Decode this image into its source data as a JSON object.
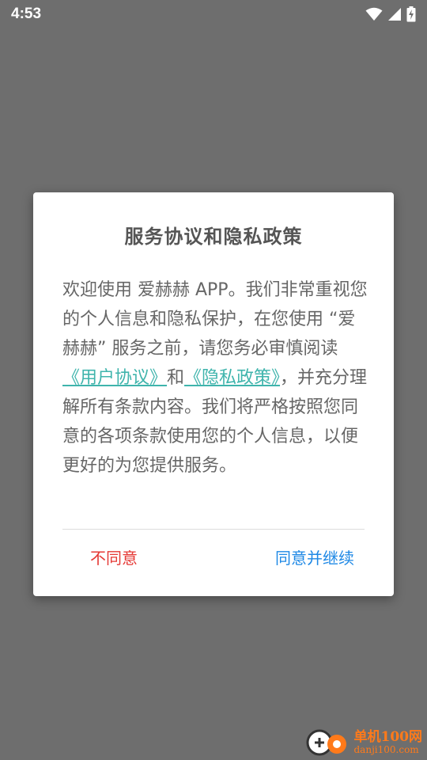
{
  "status_bar": {
    "time": "4:53"
  },
  "dialog": {
    "title": "服务协议和隐私政策",
    "body": {
      "part1": "欢迎使用 爱赫赫 APP。我们非常重视您的个人信息和隐私保护，在您使用 “爱赫赫” 服务之前，请您务必审慎阅读",
      "link_user_agreement": "《用户协议》",
      "and": "和",
      "link_privacy_policy": "《隐私政策》",
      "part2": "，并充分理解所有条款内容。我们将严格按照您同意的各项条款使用您的个人信息，以便更好的为您提供服务。"
    },
    "buttons": {
      "disagree": "不同意",
      "agree": "同意并继续"
    }
  },
  "watermark": {
    "name": "单机100网",
    "url": "danji100.com"
  },
  "colors": {
    "overlay": "#6e6e6e",
    "link": "#3fb4ac",
    "disagree": "#e53935",
    "agree": "#1e88e5"
  }
}
